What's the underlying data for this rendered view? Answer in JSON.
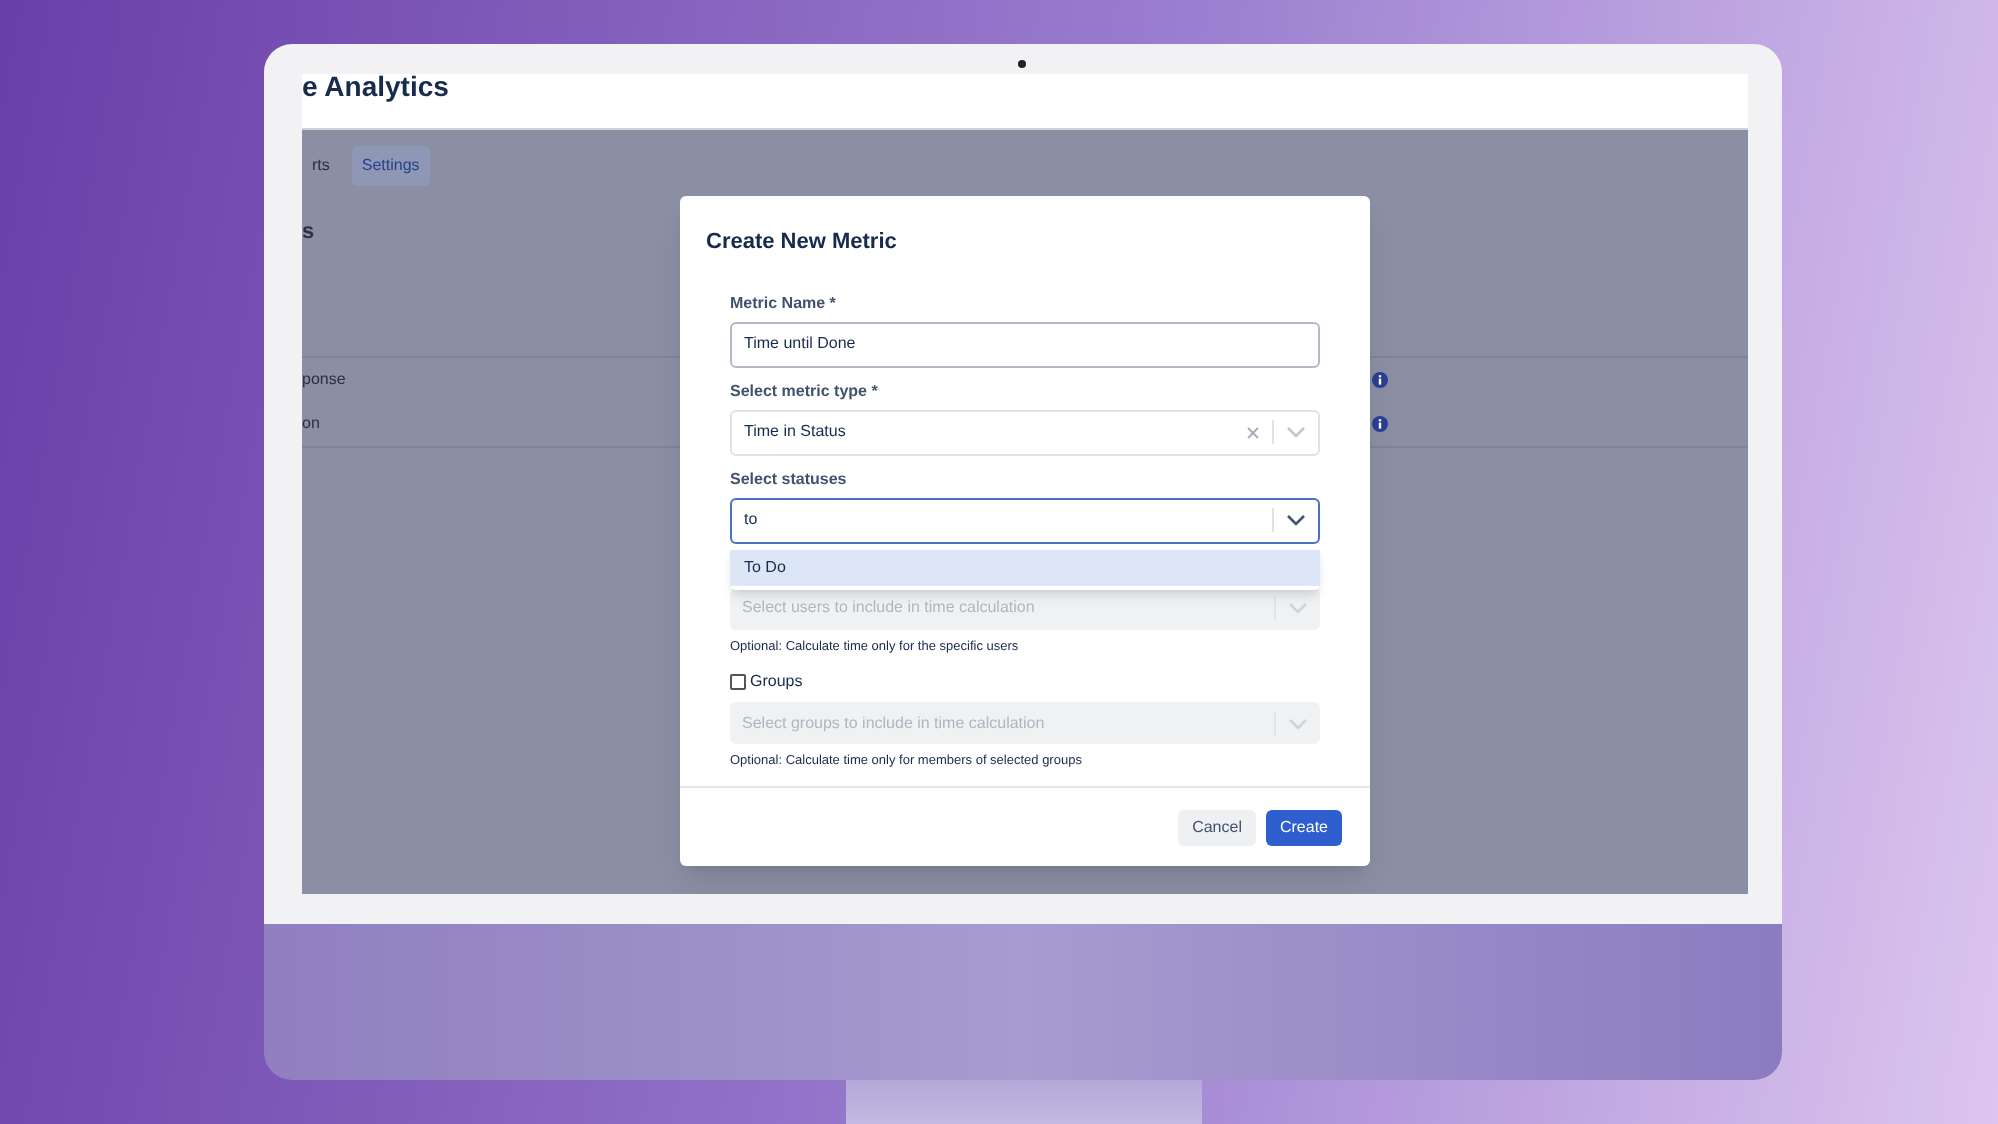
{
  "app": {
    "title": "e Analytics",
    "tabs": [
      {
        "label": "rts",
        "selected": false
      },
      {
        "label": "Settings",
        "selected": true
      }
    ],
    "section_heading": "s",
    "rows": [
      {
        "label": "ponse",
        "info": true
      },
      {
        "label": "on",
        "info": true
      }
    ]
  },
  "dialog": {
    "title": "Create New Metric",
    "fields": [
      {
        "kind": "text",
        "label": "Metric Name *",
        "value": "Time until Done"
      },
      {
        "kind": "select",
        "label": "Select metric type *",
        "value": "Time in Status",
        "clearable": true
      },
      {
        "kind": "combo",
        "label": "Select statuses",
        "value": "to",
        "focused": true
      }
    ],
    "menu": [
      {
        "label": "To Do",
        "selected": true
      }
    ],
    "filters": [
      {
        "placeholder": "Select users to include in time calculation",
        "hint": "Optional: Calculate time only for the specific users",
        "disabled": true
      },
      {
        "label": "Groups",
        "checked": false,
        "placeholder": "Select groups to include in time calculation",
        "hint": "Optional: Calculate time only for members of selected groups",
        "disabled": true
      }
    ],
    "buttons": [
      {
        "kind": "secondary",
        "label": "Cancel"
      },
      {
        "kind": "primary",
        "label": "Create"
      }
    ]
  }
}
